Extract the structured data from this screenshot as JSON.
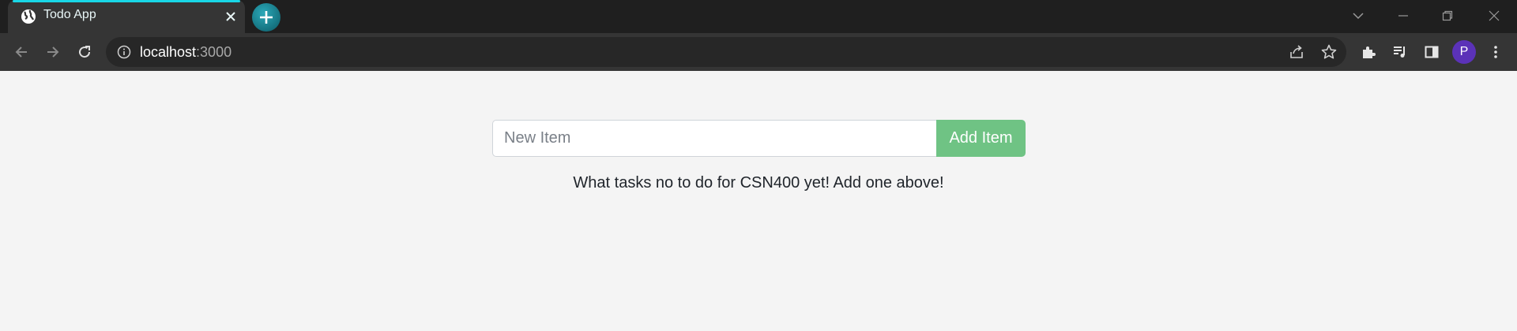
{
  "browser": {
    "tab": {
      "title": "Todo App",
      "favicon": "globe-icon"
    },
    "new_tab": "plus-icon",
    "window_controls": [
      "chevron-down-icon",
      "minimize-icon",
      "restore-icon",
      "close-icon"
    ],
    "address": {
      "host": "localhost",
      "port": ":3000"
    },
    "profile_initial": "P",
    "colors": {
      "tab_accent": "#19d6e6",
      "avatar": "#5b32b8"
    }
  },
  "todo": {
    "input_placeholder": "New Item",
    "input_value": "",
    "add_button_label": "Add Item",
    "empty_message": "What tasks no to do for CSN400 yet! Add one above!",
    "colors": {
      "button": "#6fc384",
      "background": "#f4f4f4"
    }
  }
}
